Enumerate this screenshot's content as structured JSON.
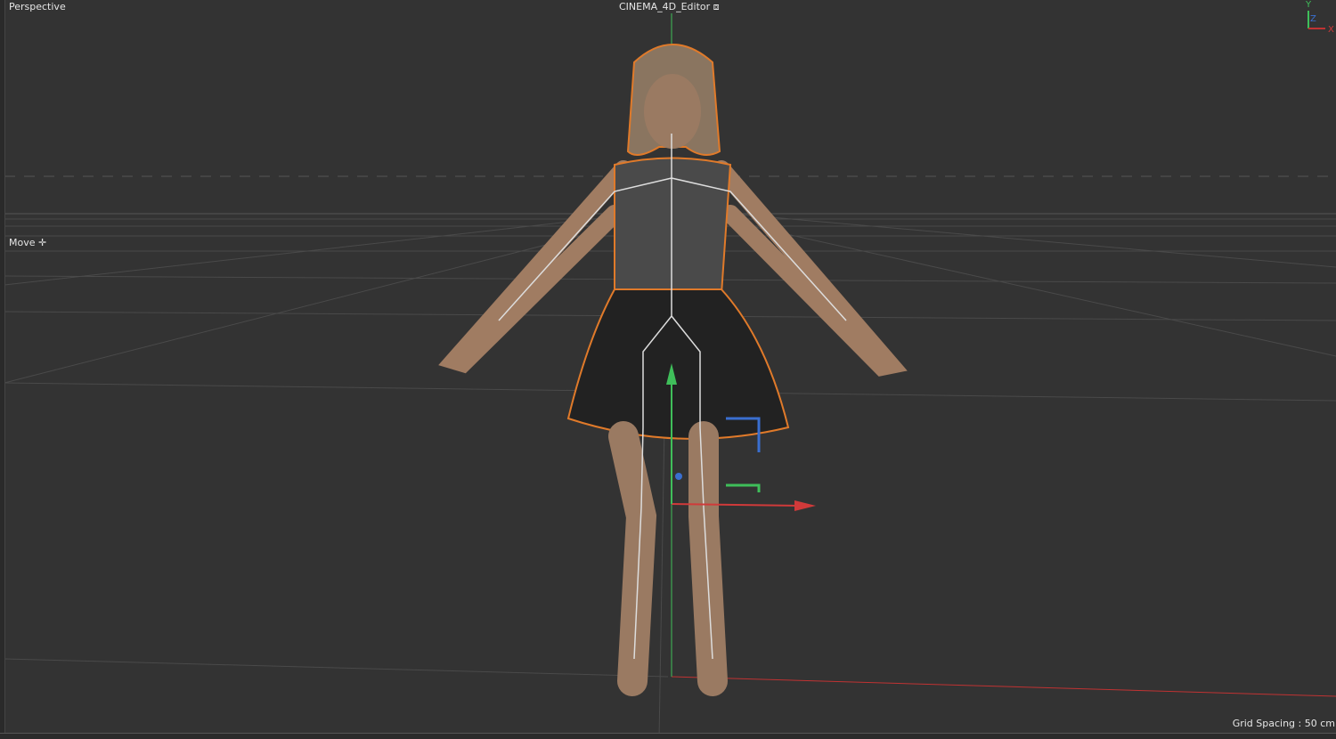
{
  "viewport": {
    "camera": "Perspective",
    "title": "CINEMA_4D_Editor",
    "tool": "Move",
    "grid_spacing": "Grid Spacing : 50 cm",
    "axis_labels": {
      "y": "Y",
      "z": "Z",
      "x": "X"
    }
  },
  "colors": {
    "background": "#333333",
    "x_axis": "#d03a3a",
    "y_axis": "#3fbf5a",
    "z_axis": "#3a6fd0",
    "selection": "#e07a2a"
  }
}
